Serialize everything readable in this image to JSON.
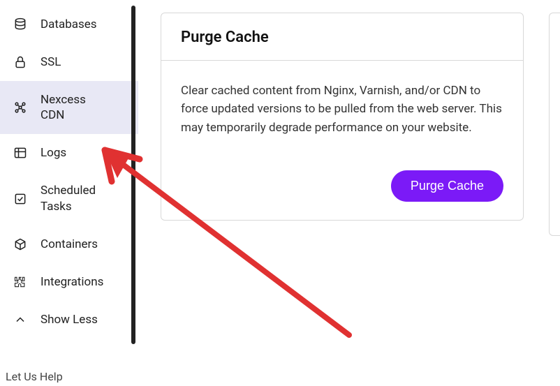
{
  "sidebar": {
    "items": [
      {
        "label": "Databases"
      },
      {
        "label": "SSL"
      },
      {
        "label": "Nexcess CDN"
      },
      {
        "label": "Logs"
      },
      {
        "label": "Scheduled Tasks"
      },
      {
        "label": "Containers"
      },
      {
        "label": "Integrations"
      },
      {
        "label": "Show Less"
      }
    ],
    "footer": "Let Us Help"
  },
  "card": {
    "title": "Purge Cache",
    "description": "Clear cached content from Nginx, Varnish, and/or CDN to force updated versions to be pulled from the web server. This may temporarily degrade performance on your website.",
    "button": "Purge Cache"
  }
}
